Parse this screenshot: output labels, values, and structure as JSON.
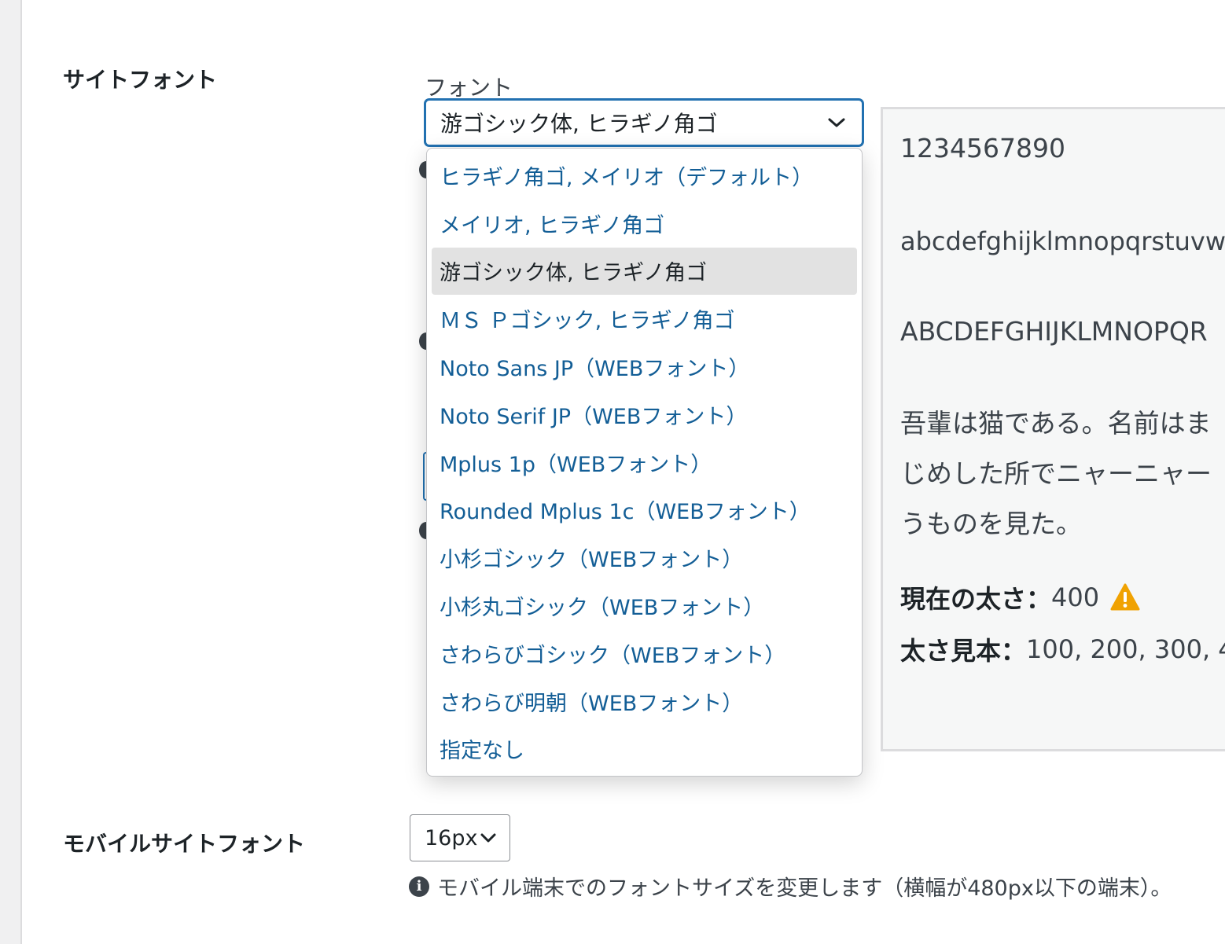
{
  "site_font": {
    "row_label": "サイトフォント",
    "field_label": "フォント",
    "selected_value": "游ゴシック体, ヒラギノ角ゴ",
    "options": [
      "ヒラギノ角ゴ, メイリオ（デフォルト）",
      "メイリオ, ヒラギノ角ゴ",
      "游ゴシック体, ヒラギノ角ゴ",
      "ＭＳ Ｐゴシック, ヒラギノ角ゴ",
      "Noto Sans JP（WEBフォント）",
      "Noto Serif JP（WEBフォント）",
      "Mplus 1p（WEBフォント）",
      "Rounded Mplus 1c（WEBフォント）",
      "小杉ゴシック（WEBフォント）",
      "小杉丸ゴシック（WEBフォント）",
      "さわらびゴシック（WEBフォント）",
      "さわらび明朝（WEBフォント）",
      "指定なし"
    ],
    "selected_index": 2
  },
  "preview": {
    "numbers": "1234567890",
    "lowercase": "abcdefghijklmnopqrstuvw",
    "uppercase": "ABCDEFGHIJKLMNOPQR",
    "japanese_lines": [
      "吾輩は猫である。名前はま",
      "じめした所でニャーニャー",
      "うものを見た。"
    ],
    "current_weight_label": "現在の太さ：",
    "current_weight_value": "400",
    "weight_sample_label": "太さ見本：",
    "weight_sample_values": "100, 200, 300, 4",
    "warning_icon": "warning-icon"
  },
  "mobile_font": {
    "row_label": "モバイルサイトフォント",
    "selected_value": "16px",
    "help_text": "モバイル端末でのフォントサイズを変更します（横幅が480px以下の端末）。",
    "info_icon": "info-icon"
  },
  "colors": {
    "accent": "#2271b1",
    "option_text": "#135e96",
    "selected_bg": "#e2e2e2",
    "warning": "#f0a202"
  }
}
